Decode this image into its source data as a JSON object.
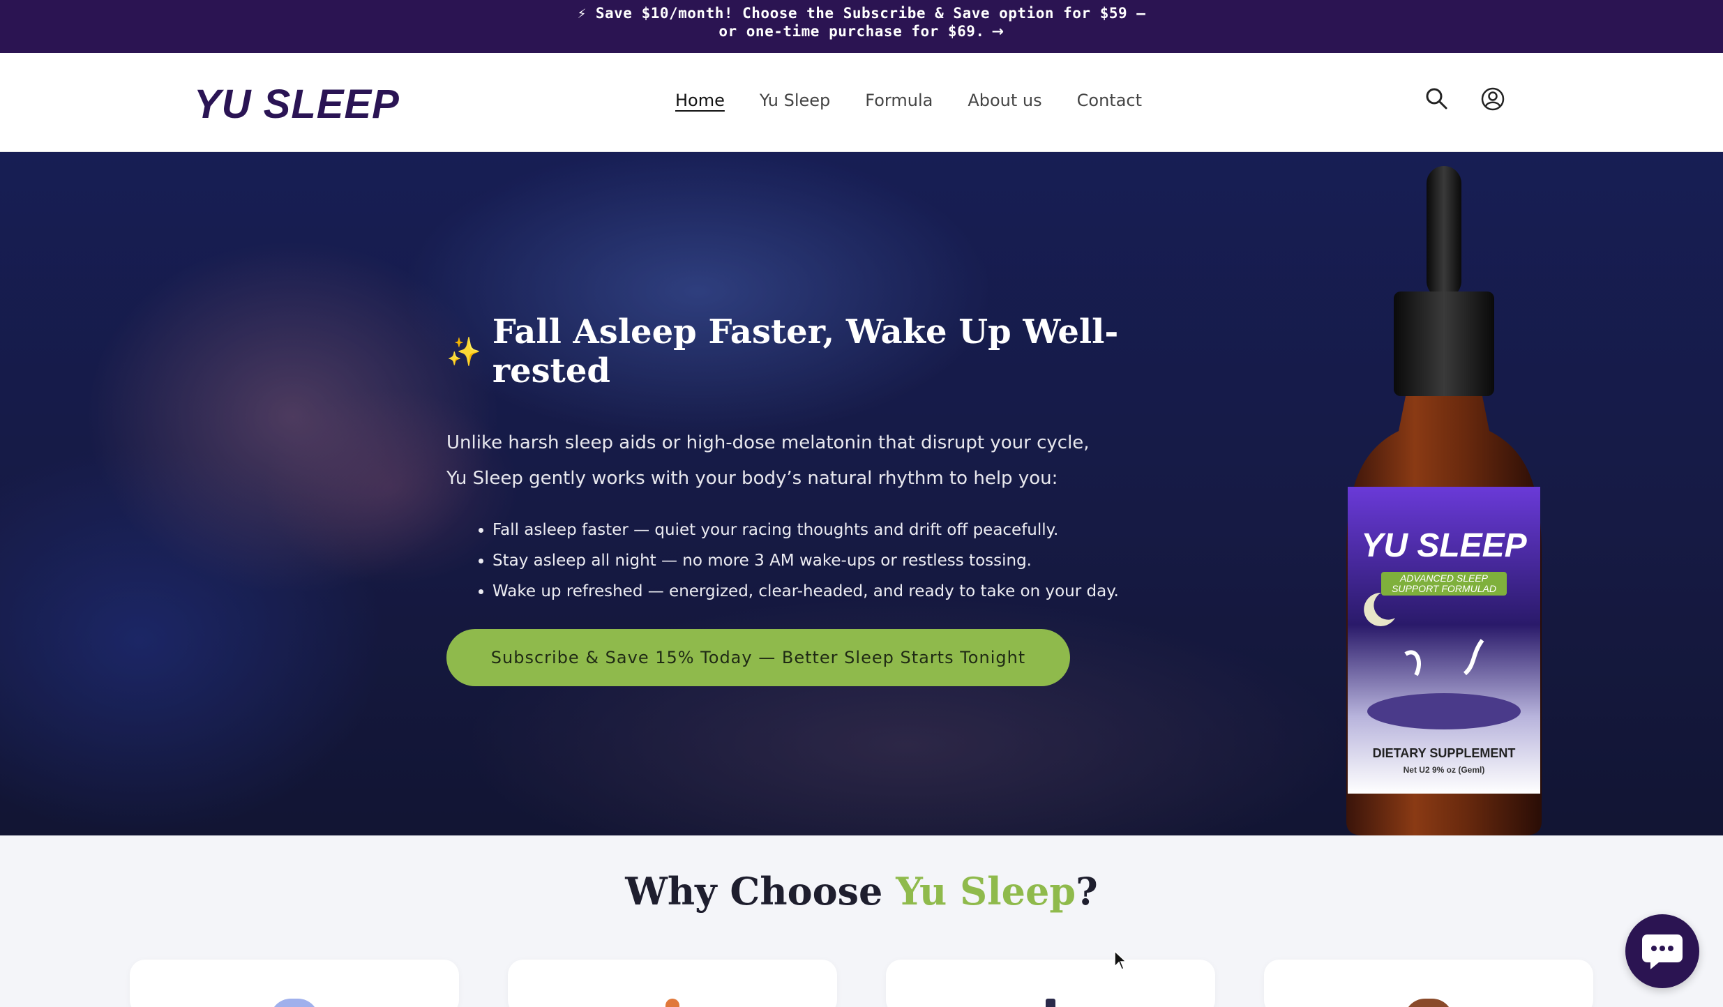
{
  "announcement": {
    "line1": "⚡ Save $10/month! Choose the Subscribe & Save option for $59 —",
    "line2": "or one-time purchase for $69.",
    "arrow": "→"
  },
  "header": {
    "logo": "YU SLEEP",
    "nav": [
      {
        "label": "Home",
        "active": true
      },
      {
        "label": "Yu Sleep",
        "active": false
      },
      {
        "label": "Formula",
        "active": false
      },
      {
        "label": "About us",
        "active": false
      },
      {
        "label": "Contact",
        "active": false
      }
    ],
    "icons": [
      "search-icon",
      "account-icon"
    ]
  },
  "hero": {
    "sparkle": "✨",
    "title": "Fall Asleep Faster, Wake Up Well-rested",
    "intro_line1": "Unlike harsh sleep aids or high-dose melatonin that disrupt your cycle,",
    "intro_line2": "Yu Sleep gently works with your body’s natural rhythm to help you:",
    "benefits": [
      "Fall asleep faster — quiet your racing thoughts and drift off peacefully.",
      "Stay asleep all night — no more 3 AM wake-ups or restless tossing.",
      "Wake up refreshed — energized, clear-headed, and ready to take on your day."
    ],
    "cta_label": "Subscribe & Save 15% Today — Better Sleep Starts Tonight"
  },
  "bottle": {
    "brand": "YU SLEEP",
    "subtitle1": "ADVANCED SLEEP",
    "subtitle2": "SUPPORT FORMULAD",
    "label1": "DIETARY SUPPLEMENT",
    "label2": "Net U2 9% oz (Geml)"
  },
  "why": {
    "title_prefix": "Why Choose ",
    "title_highlight": "Yu Sleep",
    "title_suffix": "?"
  },
  "colors": {
    "brand_purple": "#2b1452",
    "accent_green": "#8fba4c"
  }
}
